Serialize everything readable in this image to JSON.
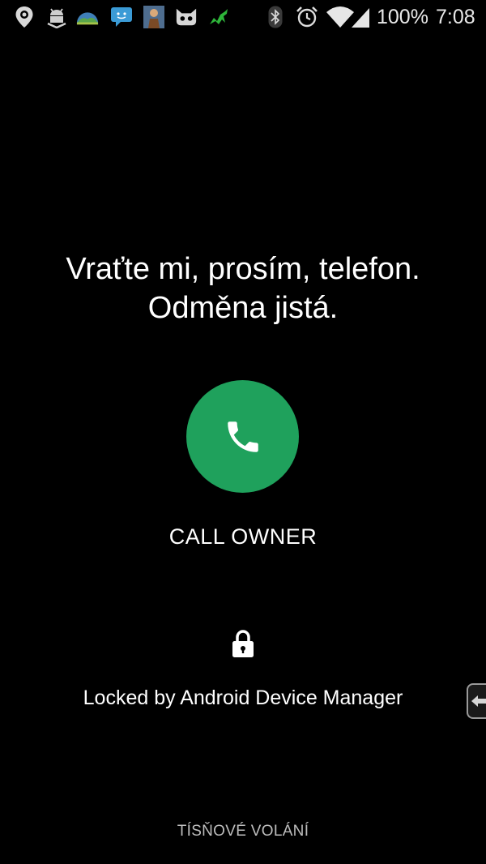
{
  "status_bar": {
    "notification_icons": [
      "location-pin-icon",
      "android-download-icon",
      "landscape-app-icon",
      "chat-bubble-icon",
      "person-portrait-icon",
      "cat-face-icon",
      "green-dragon-icon"
    ],
    "system_icons": [
      "bluetooth-icon",
      "alarm-clock-icon",
      "wifi-icon",
      "signal-icon"
    ],
    "battery": "100%",
    "time": "7:08"
  },
  "lock_screen": {
    "message_line1": "Vraťte mi, prosím, telefon.",
    "message_line2": "Odměna jistá.",
    "call_button_icon": "phone-icon",
    "call_label": "CALL OWNER",
    "lock_icon": "padlock-icon",
    "locked_by": "Locked by Android Device Manager",
    "emergency_label": "TÍSŇOVÉ VOLÁNÍ"
  },
  "colors": {
    "background": "#000000",
    "call_button": "#1fa15c",
    "text": "#ffffff",
    "emergency_text": "#bdbdbd"
  }
}
